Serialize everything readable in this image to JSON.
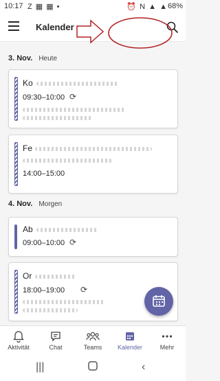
{
  "statusbar": {
    "time": "10:17",
    "notifications": "Z ▦ ▦ •",
    "system_icons": "⏰ N ▲ ▲",
    "battery": "68%"
  },
  "appbar": {
    "title": "Kalender"
  },
  "days": [
    {
      "date": "3. Nov.",
      "relative": "Heute",
      "events": [
        {
          "title": "Ko",
          "time": "09:30–10:00",
          "recurring": true
        },
        {
          "title": "Fe",
          "time": "14:00–15:00",
          "recurring": false
        }
      ]
    },
    {
      "date": "4. Nov.",
      "relative": "Morgen",
      "events": [
        {
          "title": "Ab",
          "time": "09:00–10:00",
          "recurring": true
        },
        {
          "title": "Or",
          "time": "18:00–19:00",
          "recurring": true
        }
      ]
    }
  ],
  "bottom_nav": [
    {
      "label": "Aktivität",
      "icon": "bell-icon"
    },
    {
      "label": "Chat",
      "icon": "chat-icon"
    },
    {
      "label": "Teams",
      "icon": "teams-icon"
    },
    {
      "label": "Kalender",
      "icon": "calendar-icon",
      "active": true
    },
    {
      "label": "Mehr",
      "icon": "more-dots-icon"
    }
  ],
  "colors": {
    "accent": "#6264a7",
    "annotation_red": "#b22222"
  }
}
